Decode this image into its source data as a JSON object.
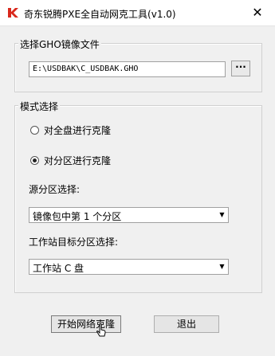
{
  "window": {
    "title": "奇东锐腾PXE全自动网克工具(v1.0)",
    "close_glyph": "✕"
  },
  "ghost_group": {
    "legend": "选择GHO镜像文件",
    "path_value": "E:\\USDBAK\\C_USDBAK.GHO",
    "browse_label": "···"
  },
  "mode_group": {
    "legend": "模式选择",
    "options": [
      {
        "label": "对全盘进行克隆",
        "checked": false
      },
      {
        "label": "对分区进行克隆",
        "checked": true
      }
    ],
    "source_label": "源分区选择:",
    "source_value": "镜像包中第 1 个分区",
    "target_label": "工作站目标分区选择:",
    "target_value": "工作站 C 盘"
  },
  "buttons": {
    "start_label": "开始网络克隆",
    "exit_label": "退出"
  },
  "colors": {
    "icon_red": "#d9281c",
    "window_bg": "#f0f0f0"
  }
}
